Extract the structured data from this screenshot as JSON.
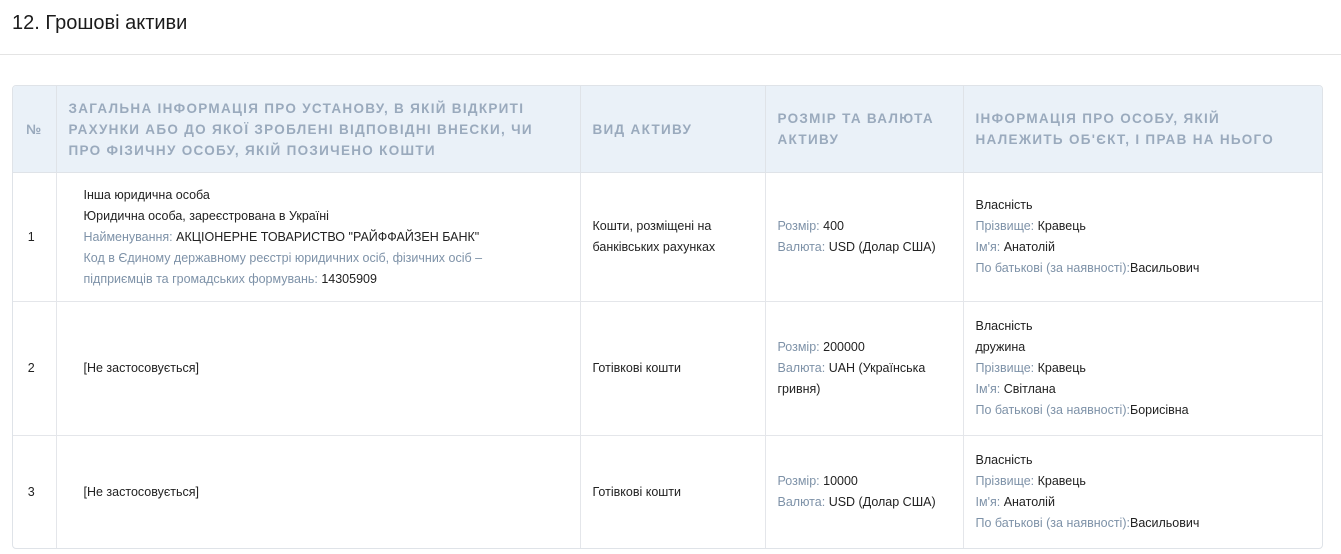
{
  "section": {
    "title": "12. Грошові активи"
  },
  "table": {
    "headers": {
      "num": "№",
      "institution": "Загальна інформація про установу, в якій відкриті рахунки або до якої зроблені відповідні внески, чи про фізичну особу, якій позичено кошти",
      "asset_type": "Вид активу",
      "size_currency": "Розмір та валюта активу",
      "owner": "Інформація про особу, якій належить об'єкт, і прав на нього"
    },
    "labels": {
      "size": "Розмір:",
      "currency": "Валюта:",
      "surname": "Прізвище:",
      "name": "Ім'я:",
      "patronymic": "По батькові (за наявності):",
      "org_name": "Найменування:",
      "edrpou": "Код в Єдиному державному реєстрі юридичних осіб, фізичних осіб – підприємців та громадських формувань:"
    },
    "rows": [
      {
        "num": "1",
        "institution": {
          "type": "Інша юридична особа",
          "subtype": "Юридична особа, зареєстрована в Україні",
          "name": "АКЦІОНЕРНЕ ТОВАРИСТВО \"РАЙФФАЙЗЕН БАНК\"",
          "code": "14305909"
        },
        "asset_type": "Кошти, розміщені на банківських рахунках",
        "size": "400",
        "currency": "USD (Долар США)",
        "owner": {
          "right": "Власність",
          "relation": "",
          "surname": "Кравець",
          "name": "Анатолій",
          "patronymic": "Васильович"
        }
      },
      {
        "num": "2",
        "institution_text": "[Не застосовується]",
        "asset_type": "Готівкові кошти",
        "size": "200000",
        "currency": "UAH (Українська гривня)",
        "owner": {
          "right": "Власність",
          "relation": "дружина",
          "surname": "Кравець",
          "name": "Світлана",
          "patronymic": "Борисівна"
        }
      },
      {
        "num": "3",
        "institution_text": "[Не застосовується]",
        "asset_type": "Готівкові кошти",
        "size": "10000",
        "currency": "USD (Долар США)",
        "owner": {
          "right": "Власність",
          "relation": "",
          "surname": "Кравець",
          "name": "Анатолій",
          "patronymic": "Васильович"
        }
      }
    ]
  }
}
